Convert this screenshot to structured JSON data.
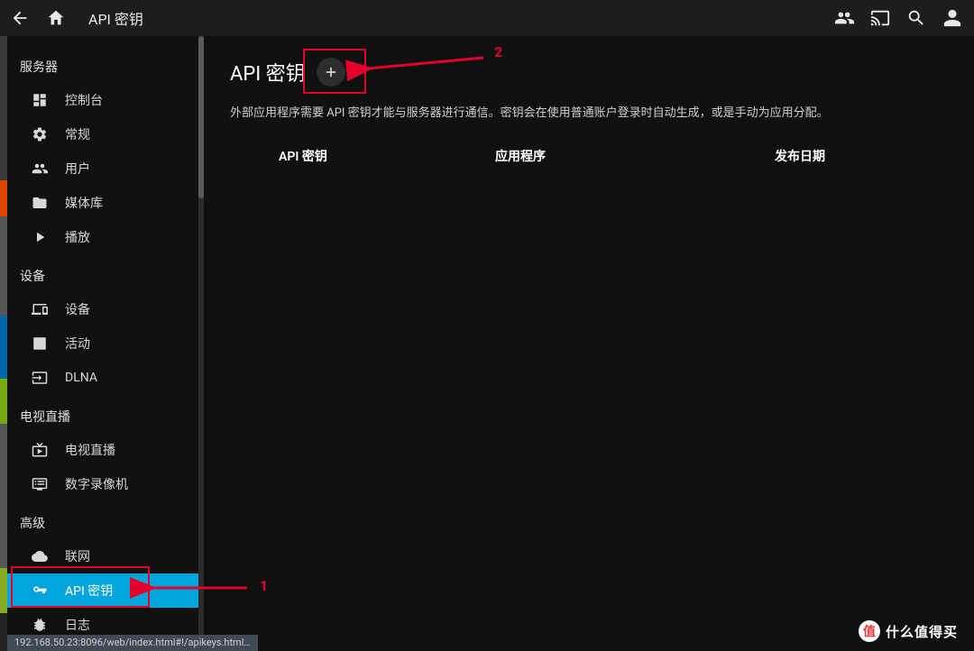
{
  "header": {
    "title": "API 密钥"
  },
  "sidebar": {
    "sections": {
      "server": {
        "label": "服务器"
      },
      "devices": {
        "label": "设备"
      },
      "livetv": {
        "label": "电视直播"
      },
      "advanced": {
        "label": "高级"
      }
    },
    "items": {
      "console": {
        "label": "控制台"
      },
      "general": {
        "label": "常规"
      },
      "users": {
        "label": "用户"
      },
      "library": {
        "label": "媒体库"
      },
      "playback": {
        "label": "播放"
      },
      "devicelist": {
        "label": "设备"
      },
      "activity": {
        "label": "活动"
      },
      "dlna": {
        "label": "DLNA"
      },
      "livetv": {
        "label": "电视直播"
      },
      "dvr": {
        "label": "数字录像机"
      },
      "network": {
        "label": "联网"
      },
      "apikeys": {
        "label": "API 密钥"
      },
      "logs": {
        "label": "日志"
      }
    }
  },
  "main": {
    "title": "API 密钥",
    "desc": "外部应用程序需要 API 密钥才能与服务器进行通信。密钥会在使用普通账户登录时自动生成，或是手动为应用分配。",
    "columns": {
      "key": "API 密钥",
      "app": "应用程序",
      "date": "发布日期"
    }
  },
  "annotations": {
    "a1": "1",
    "a2": "2"
  },
  "statusbar": {
    "url": "192.168.50.23:8096/web/index.html#!/apikeys.html…"
  },
  "watermark": {
    "badge": "值",
    "text": "什么值得买"
  }
}
